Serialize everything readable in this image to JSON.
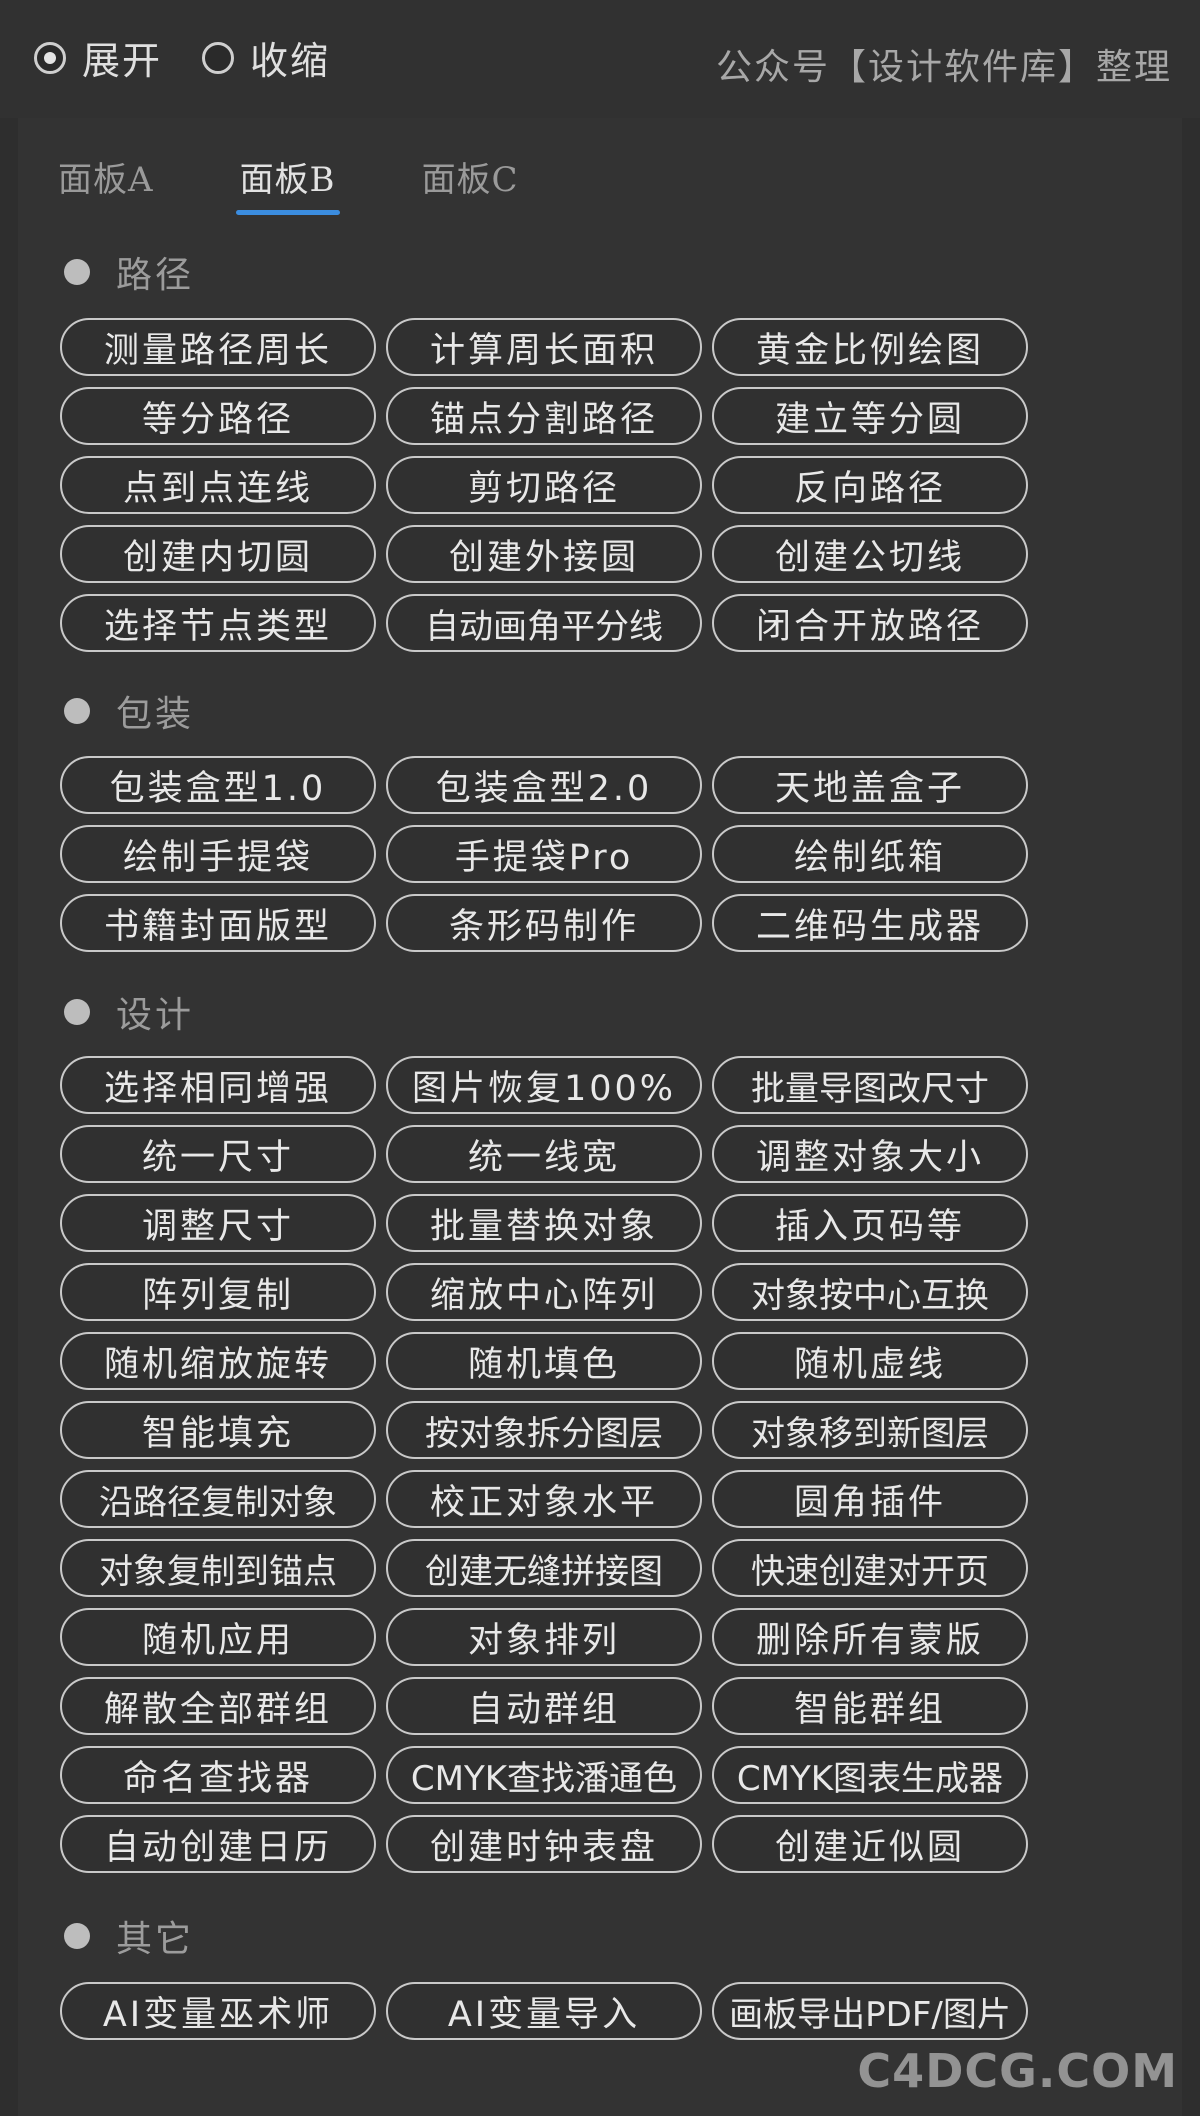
{
  "header": {
    "expand_label": "展开",
    "collapse_label": "收缩",
    "selected": "expand",
    "credit": "公众号【设计软件库】整理"
  },
  "tabs": [
    "面板A",
    "面板B",
    "面板C"
  ],
  "active_tab": 1,
  "sections": [
    {
      "title": "路径",
      "buttons": [
        "测量路径周长",
        "计算周长面积",
        "黄金比例绘图",
        "等分路径",
        "锚点分割路径",
        "建立等分圆",
        "点到点连线",
        "剪切路径",
        "反向路径",
        "创建内切圆",
        "创建外接圆",
        "创建公切线",
        "选择节点类型",
        "自动画角平分线",
        "闭合开放路径"
      ]
    },
    {
      "title": "包装",
      "buttons": [
        "包装盒型1.0",
        "包装盒型2.0",
        "天地盖盒子",
        "绘制手提袋",
        "手提袋Pro",
        "绘制纸箱",
        "书籍封面版型",
        "条形码制作",
        "二维码生成器"
      ]
    },
    {
      "title": "设计",
      "buttons": [
        "选择相同增强",
        "图片恢复100%",
        "批量导图改尺寸",
        "统一尺寸",
        "统一线宽",
        "调整对象大小",
        "调整尺寸",
        "批量替换对象",
        "插入页码等",
        "阵列复制",
        "缩放中心阵列",
        "对象按中心互换",
        "随机缩放旋转",
        "随机填色",
        "随机虚线",
        "智能填充",
        "按对象拆分图层",
        "对象移到新图层",
        "沿路径复制对象",
        "校正对象水平",
        "圆角插件",
        "对象复制到锚点",
        "创建无缝拼接图",
        "快速创建对开页",
        "随机应用",
        "对象排列",
        "删除所有蒙版",
        "解散全部群组",
        "自动群组",
        "智能群组",
        "命名查找器",
        "CMYK查找潘通色",
        "CMYK图表生成器",
        "自动创建日历",
        "创建时钟表盘",
        "创建近似圆"
      ]
    },
    {
      "title": "其它",
      "buttons": [
        "AI变量巫术师",
        "AI变量导入",
        "画板导出PDF/图片"
      ]
    }
  ],
  "watermark": "C4DCG.COM",
  "colors": {
    "background": "#2e2e2e",
    "tab_underline": "#3b8de0",
    "button_border": "#c9c9c9"
  }
}
